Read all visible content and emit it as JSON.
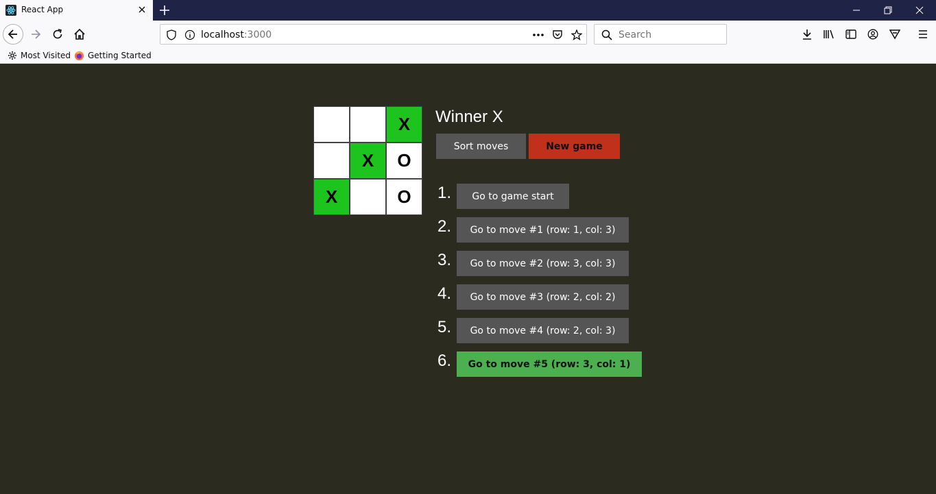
{
  "browser": {
    "tab_title": "React App",
    "url_host": "localhost",
    "url_port": ":3000",
    "search_placeholder": "Search",
    "bookmarks": [
      {
        "label": "Most Visited",
        "icon": "gear-icon"
      },
      {
        "label": "Getting Started",
        "icon": "firefox-icon"
      }
    ]
  },
  "game": {
    "status": "Winner X",
    "sort_label": "Sort moves",
    "new_game_label": "New game",
    "board": [
      {
        "value": "",
        "winning": false
      },
      {
        "value": "",
        "winning": false
      },
      {
        "value": "X",
        "winning": true
      },
      {
        "value": "",
        "winning": false
      },
      {
        "value": "X",
        "winning": true
      },
      {
        "value": "O",
        "winning": false
      },
      {
        "value": "X",
        "winning": true
      },
      {
        "value": "",
        "winning": false
      },
      {
        "value": "O",
        "winning": false
      }
    ],
    "moves": [
      {
        "num": "1.",
        "label": "Go to game start",
        "current": false
      },
      {
        "num": "2.",
        "label": "Go to move #1 (row: 1, col: 3)",
        "current": false
      },
      {
        "num": "3.",
        "label": "Go to move #2 (row: 3, col: 3)",
        "current": false
      },
      {
        "num": "4.",
        "label": "Go to move #3 (row: 2, col: 2)",
        "current": false
      },
      {
        "num": "5.",
        "label": "Go to move #4 (row: 2, col: 3)",
        "current": false
      },
      {
        "num": "6.",
        "label": "Go to move #5 (row: 3, col: 1)",
        "current": true
      }
    ]
  },
  "colors": {
    "page_background": "#2b2b20",
    "winning_square": "#1ec41e",
    "button": "#555555",
    "new_game_button": "#c0301a",
    "current_move_button": "#4caf50"
  }
}
